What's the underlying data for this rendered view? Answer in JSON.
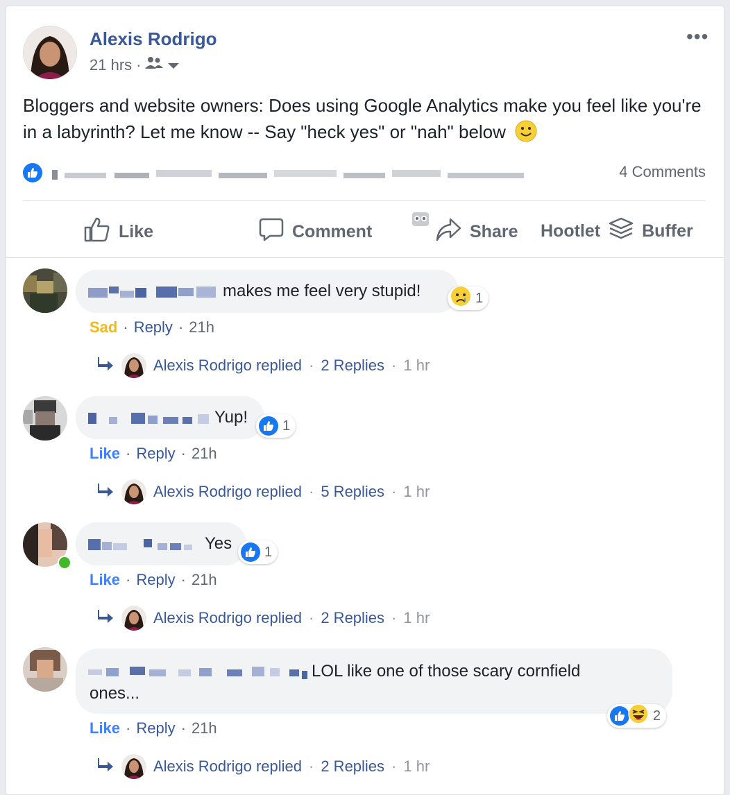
{
  "post": {
    "author": "Alexis Rodrigo",
    "time": "21 hrs",
    "separator": "·",
    "text": "Bloggers and website owners: Does using Google Analytics make you feel like you're in a labyrinth? Let me know -- Say \"heck yes\" or \"nah\" below",
    "comments_count": "4 Comments",
    "more_label": "•••"
  },
  "actions": {
    "like": "Like",
    "comment": "Comment",
    "share": "Share",
    "hootlet": "Hootlet",
    "buffer": "Buffer"
  },
  "comments": [
    {
      "text": "makes me feel very stupid!",
      "reaction_count": "1",
      "reaction": "sad",
      "status": "Sad",
      "reply_label": "Reply",
      "time": "21h",
      "replied_by": "Alexis Rodrigo replied",
      "replies": "2 Replies",
      "reply_time": "1 hr"
    },
    {
      "text": "Yup!",
      "reaction_count": "1",
      "reaction": "like",
      "status": "Like",
      "reply_label": "Reply",
      "time": "21h",
      "replied_by": "Alexis Rodrigo replied",
      "replies": "5 Replies",
      "reply_time": "1 hr"
    },
    {
      "text": "Yes",
      "reaction_count": "1",
      "reaction": "like",
      "status": "Like",
      "reply_label": "Reply",
      "time": "21h",
      "replied_by": "Alexis Rodrigo replied",
      "replies": "2 Replies",
      "reply_time": "1 hr"
    },
    {
      "text": "LOL like one of those scary cornfield",
      "text2": "ones...",
      "reaction_count": "2",
      "reaction": "like+haha",
      "status": "Like",
      "reply_label": "Reply",
      "time": "21h",
      "replied_by": "Alexis Rodrigo replied",
      "replies": "2 Replies",
      "reply_time": "1 hr"
    }
  ],
  "colors": {
    "link": "#385898",
    "like_blue": "#1877f2",
    "sad_yellow": "#f0ba15",
    "muted": "#606770",
    "bubble": "#f2f3f5"
  },
  "icons": [
    "more-options-icon",
    "friends-audience-icon",
    "chevron-down-icon",
    "smile-emoji-icon",
    "like-thumb-icon",
    "comment-icon",
    "share-icon",
    "hootlet-owl-icon",
    "buffer-icon",
    "sad-reaction-icon",
    "haha-reaction-icon",
    "reply-arrow-icon"
  ]
}
